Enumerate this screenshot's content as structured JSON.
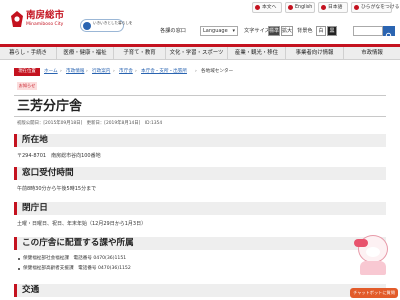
{
  "header": {
    "logo_name": "南房総市",
    "logo_sub": "Minamiboso City",
    "banner_text": "いきいきとした暮らしを",
    "top_links": [
      "本文へ",
      "English",
      "日本語",
      "ひらがなをつける"
    ],
    "tools": {
      "site_map": "各課の窓口",
      "language_label": "Language",
      "language_value": "",
      "text_size_label": "文字サイズ",
      "size_options": [
        "標準",
        "拡大"
      ],
      "color_label": "背景色",
      "color_options": [
        "白",
        "黒"
      ],
      "search_placeholder": ""
    }
  },
  "nav": {
    "items": [
      "暮らし・手続き",
      "医療・健康・福祉",
      "子育て・教育",
      "文化・学習・スポーツ",
      "産業・観光・移住",
      "事業者向け情報",
      "市政情報"
    ]
  },
  "breadcrumb": {
    "label": "現在位置",
    "items": [
      "ホーム",
      "市政情報",
      "行政案内",
      "市庁舎",
      "本庁舎・支所・出張所",
      "各地域センター"
    ]
  },
  "tag": "お知らせ",
  "page_title": "三芳分庁舎",
  "meta": "初版公開日：[2015年09月18日]　更新日：[2019年8月14日]　ID:1354",
  "sections": [
    {
      "title": "所在地",
      "text": "〒294-8701　南房総市谷向100番地"
    },
    {
      "title": "窓口受付時間",
      "text": "午前8時30分から午後5時15分まで"
    },
    {
      "title": "閉庁日",
      "text": "土曜・日曜日、祝日、年末年始（12月29日から1月3日）"
    },
    {
      "title": "この庁舎に配置する課や所属",
      "text": ""
    },
    {
      "title": "交通",
      "text": ""
    }
  ],
  "departments": [
    "保健福祉部社会福祉課　電話番号 0470(36)1151",
    "保健福祉部高齢者支援課　電話番号 0470(36)1152"
  ],
  "chat": {
    "button_label": "チャットボットに質問"
  },
  "colors": {
    "brand": "#c4121f",
    "link": "#2a64b1",
    "chat": "#e25b2a"
  }
}
